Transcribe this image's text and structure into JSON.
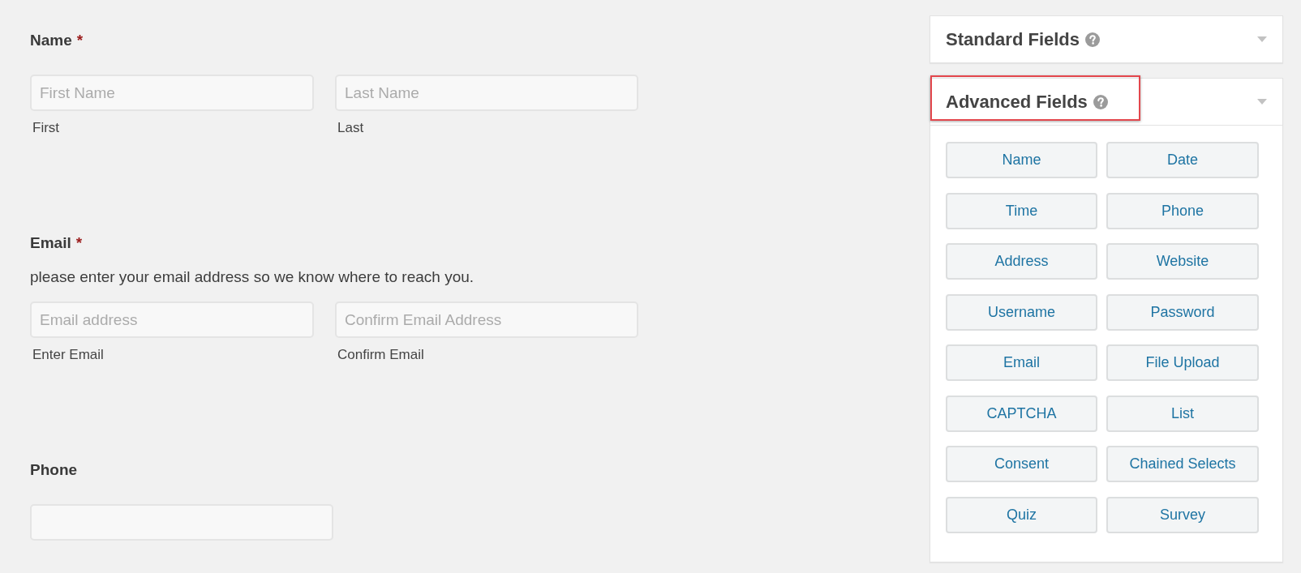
{
  "form": {
    "fields": [
      {
        "kind": "multi",
        "label": "Name",
        "required_mark": "*",
        "inputs": [
          {
            "placeholder": "First Name",
            "sublabel": "First"
          },
          {
            "placeholder": "Last Name",
            "sublabel": "Last"
          }
        ]
      },
      {
        "kind": "multi",
        "label": "Email",
        "required_mark": "*",
        "description": "please enter your email address so we know where to reach you.",
        "inputs": [
          {
            "placeholder": "Email address",
            "sublabel": "Enter Email"
          },
          {
            "placeholder": "Confirm Email Address",
            "sublabel": "Confirm Email"
          }
        ]
      },
      {
        "kind": "single",
        "label": "Phone"
      }
    ]
  },
  "sidebar": {
    "sections": [
      {
        "title": "Standard Fields",
        "expanded": false,
        "highlighted": false
      },
      {
        "title": "Advanced Fields",
        "expanded": true,
        "highlighted": true,
        "buttons": [
          "Name",
          "Date",
          "Time",
          "Phone",
          "Address",
          "Website",
          "Username",
          "Password",
          "Email",
          "File Upload",
          "CAPTCHA",
          "List",
          "Consent",
          "Chained Selects",
          "Quiz",
          "Survey"
        ]
      }
    ]
  }
}
